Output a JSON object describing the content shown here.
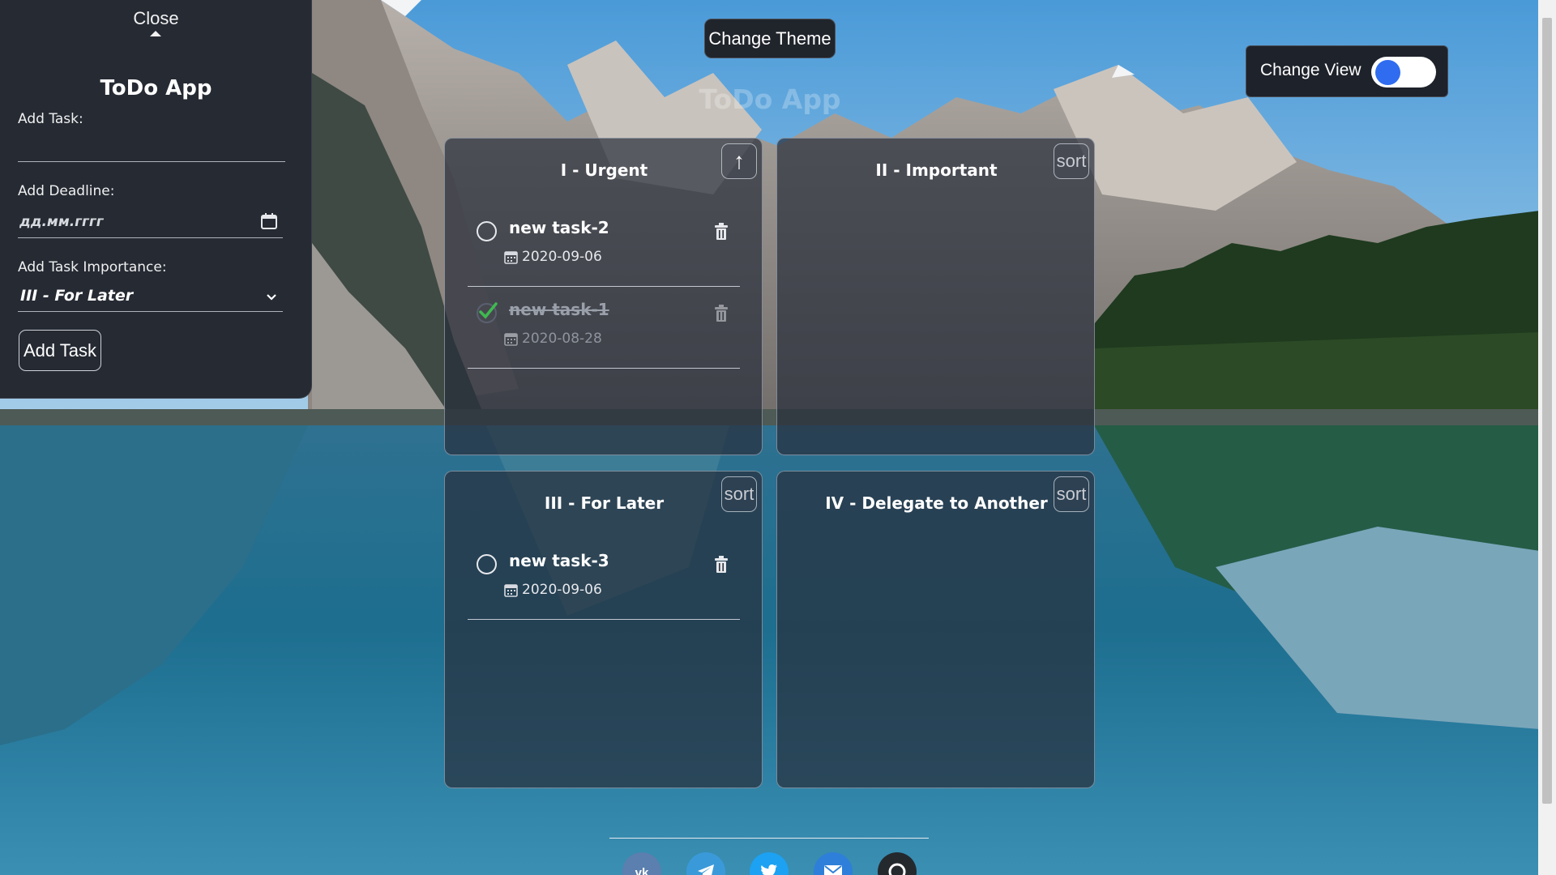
{
  "sidebar": {
    "close_label": "Close",
    "title": "ToDo App",
    "add_task_label": "Add Task:",
    "task_input_value": "",
    "add_deadline_label": "Add Deadline:",
    "deadline_placeholder": "дд.мм.гггг",
    "importance_label": "Add Task Importance:",
    "importance_selected": "III - For Later",
    "add_button_label": "Add Task"
  },
  "header": {
    "theme_button": "Change Theme",
    "view_label": "Change View",
    "view_toggle_on": true,
    "ghost_title": "ToDo App"
  },
  "quadrants": [
    {
      "title": "I - Urgent",
      "sort_label": "↑",
      "tasks": [
        {
          "name": "new task-2",
          "date": "2020-09-06",
          "done": false
        },
        {
          "name": "new task-1",
          "date": "2020-08-28",
          "done": true
        }
      ]
    },
    {
      "title": "II - Important",
      "sort_label": "sort",
      "tasks": []
    },
    {
      "title": "III - For Later",
      "sort_label": "sort",
      "tasks": [
        {
          "name": "new task-3",
          "date": "2020-09-06",
          "done": false
        }
      ]
    },
    {
      "title": "IV - Delegate to Another",
      "sort_label": "sort",
      "tasks": []
    }
  ],
  "footer": {
    "socials": [
      {
        "icon": "vk-icon",
        "color": "#5b7fae"
      },
      {
        "icon": "telegram-icon",
        "color": "#3a9ad9"
      },
      {
        "icon": "twitter-icon",
        "color": "#1da1f2"
      },
      {
        "icon": "mail-icon",
        "color": "#2e7fd9"
      },
      {
        "icon": "github-icon",
        "color": "#24292e"
      }
    ]
  },
  "colors": {
    "panel_bg": "#252a33",
    "accent_toggle": "#2f6cf0",
    "done_check": "#3fb950"
  }
}
